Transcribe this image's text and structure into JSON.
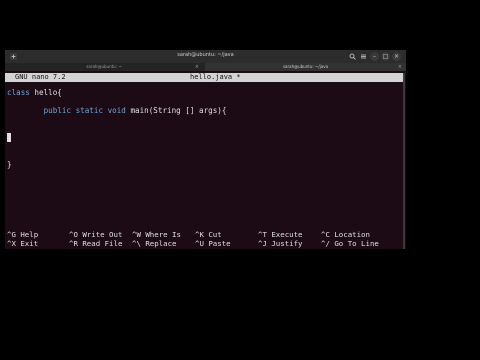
{
  "window": {
    "title": "sarah@ubuntu: ~/java",
    "tabs": [
      {
        "label": "sarah@ubuntu: ~"
      },
      {
        "label": "sarah@ubuntu: ~/java"
      }
    ]
  },
  "nano": {
    "version": "GNU nano 7.2",
    "filename": "hello.java *",
    "code": {
      "line1_kw": "class",
      "line1_rest": " hello{",
      "line3_indent": "        ",
      "line3_kw": "public static void",
      "line3_rest": " main(String [] args){",
      "line7": "}"
    },
    "shortcuts": [
      {
        "key": "^G",
        "label": "Help"
      },
      {
        "key": "^O",
        "label": "Write Out"
      },
      {
        "key": "^W",
        "label": "Where Is"
      },
      {
        "key": "^K",
        "label": "Cut"
      },
      {
        "key": "^T",
        "label": "Execute"
      },
      {
        "key": "^C",
        "label": "Location"
      },
      {
        "key": "^X",
        "label": "Exit"
      },
      {
        "key": "^R",
        "label": "Read File"
      },
      {
        "key": "^\\",
        "label": "Replace"
      },
      {
        "key": "^U",
        "label": "Paste"
      },
      {
        "key": "^J",
        "label": "Justify"
      },
      {
        "key": "^/",
        "label": "Go To Line"
      }
    ]
  },
  "colors": {
    "terminal_bg": "#1c0a14",
    "header_bg": "#d3d3d3",
    "keyword": "#6fa6d8"
  }
}
